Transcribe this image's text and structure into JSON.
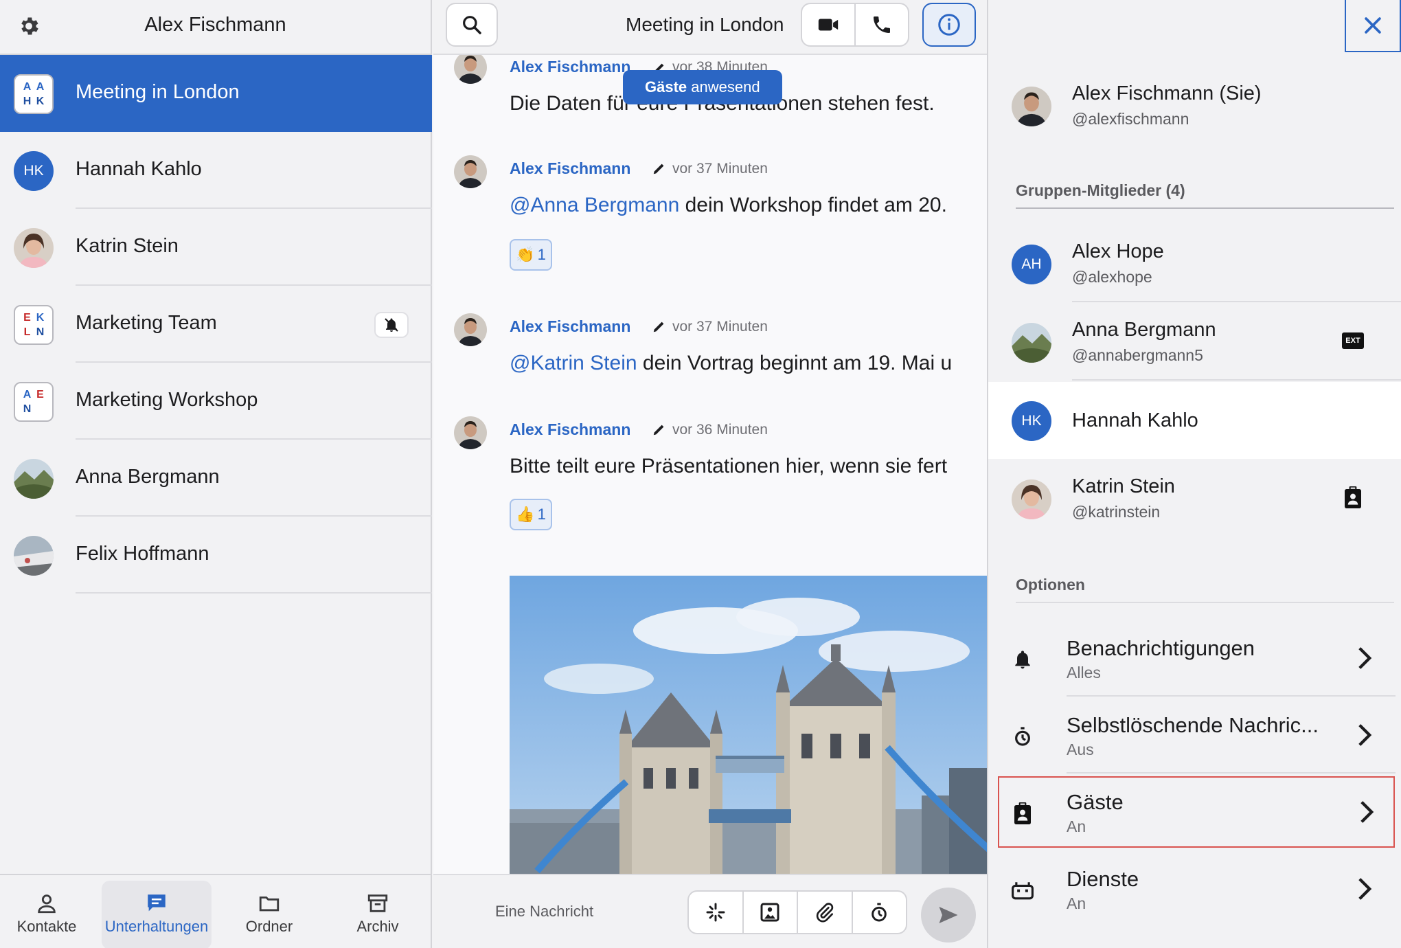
{
  "left": {
    "title": "Alex Fischmann",
    "conversations": [
      {
        "name": "Meeting in London",
        "avatar_letters": [
          "A",
          "A",
          "H",
          "K"
        ]
      },
      {
        "name": "Hannah Kahlo",
        "initials": "HK"
      },
      {
        "name": "Katrin Stein"
      },
      {
        "name": "Marketing Team",
        "avatar_letters": [
          "E",
          "K",
          "L",
          "N"
        ]
      },
      {
        "name": "Marketing Workshop",
        "avatar_letters": [
          "A",
          "E",
          "N",
          ""
        ]
      },
      {
        "name": "Anna Bergmann"
      },
      {
        "name": "Felix Hoffmann"
      }
    ],
    "nav": [
      {
        "label": "Kontakte"
      },
      {
        "label": "Unterhaltungen"
      },
      {
        "label": "Ordner"
      },
      {
        "label": "Archiv"
      }
    ]
  },
  "chat": {
    "title": "Meeting in London",
    "guests_pill_bold": "Gäste",
    "guests_pill_rest": " anwesend",
    "messages": [
      {
        "author": "Alex Fischmann",
        "time": "vor 38 Minuten",
        "text": "Die Daten für eure Präsentationen stehen fest."
      },
      {
        "author": "Alex Fischmann",
        "time": "vor 37 Minuten",
        "mention": "@Anna Bergmann",
        "text": " dein Workshop findet am 20.",
        "reaction_emoji": "👏",
        "reaction_count": "1"
      },
      {
        "author": "Alex Fischmann",
        "time": "vor 37 Minuten",
        "mention": "@Katrin Stein",
        "text": " dein Vortrag beginnt am 19. Mai u"
      },
      {
        "author": "Alex Fischmann",
        "time": "vor 36 Minuten",
        "text": "Bitte teilt eure Präsentationen hier, wenn sie fert",
        "reaction_emoji": "👍",
        "reaction_count": "1"
      }
    ],
    "composer_placeholder": "Eine Nachricht"
  },
  "info": {
    "me": {
      "name": "Alex Fischmann (Sie)",
      "handle": "@alexfischmann"
    },
    "members_label": "Gruppen-Mitglieder (4)",
    "members": [
      {
        "name": "Alex Hope",
        "handle": "@alexhope",
        "initials": "AH"
      },
      {
        "name": "Anna Bergmann",
        "handle": "@annabergmann5",
        "badge": "EXT"
      },
      {
        "name": "Hannah Kahlo",
        "handle": "",
        "initials": "HK"
      },
      {
        "name": "Katrin Stein",
        "handle": "@katrinstein"
      }
    ],
    "options_label": "Optionen",
    "options": [
      {
        "title": "Benachrichtigungen",
        "value": "Alles"
      },
      {
        "title": "Selbstlöschende Nachric...",
        "value": "Aus"
      },
      {
        "title": "Gäste",
        "value": "An"
      },
      {
        "title": "Dienste",
        "value": "An"
      }
    ]
  },
  "colors": {
    "accent": "#2b66c4",
    "selected_outline": "#d9534f"
  }
}
